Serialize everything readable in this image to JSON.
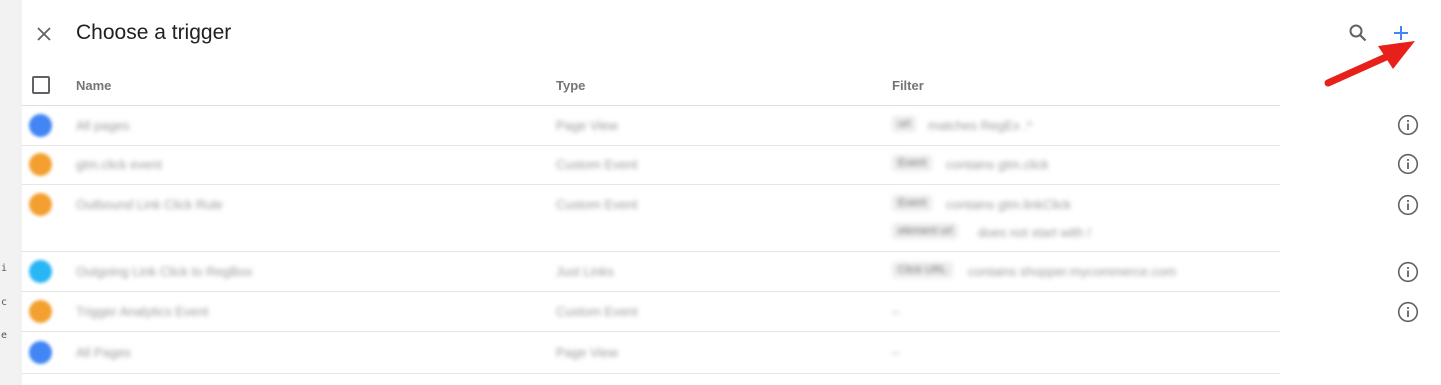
{
  "dialog": {
    "title": "Choose a trigger",
    "close_icon": "close-icon",
    "search_icon": "search-icon",
    "add_icon": "plus-icon",
    "accent_color": "#4285f4"
  },
  "table": {
    "columns": {
      "name": "Name",
      "type": "Type",
      "filter": "Filter"
    },
    "rows": [
      {
        "icon_color": "#4285f4",
        "name": "All pages",
        "type": "Page View",
        "filters": [
          {
            "chip": "url",
            "text": "matches RegEx .*"
          }
        ]
      },
      {
        "icon_color": "#f4a030",
        "name": "gtm.click event",
        "type": "Custom Event",
        "filters": [
          {
            "chip": "Event",
            "text": "contains gtm.click"
          }
        ]
      },
      {
        "icon_color": "#f4a030",
        "name": "Outbound Link Click Rule",
        "type": "Custom Event",
        "filters": [
          {
            "chip": "Event",
            "text": "contains gtm.linkClick"
          },
          {
            "chip": "element url",
            "text": "does not start with /"
          }
        ]
      },
      {
        "icon_color": "#29b6f6",
        "name": "Outgoing Link Click to RegBox",
        "type": "Just Links",
        "filters": [
          {
            "chip": "Click URL",
            "text": "contains shopper.mycommerce.com"
          }
        ]
      },
      {
        "icon_color": "#f4a030",
        "name": "Trigger Analytics Event",
        "type": "Custom Event",
        "filters": [
          {
            "chip": "",
            "text": "–"
          }
        ]
      },
      {
        "icon_color": "#4285f4",
        "name": "All Pages",
        "type": "Page View",
        "filters": [
          {
            "chip": "",
            "text": "–"
          }
        ]
      }
    ]
  },
  "annotation": {
    "arrow_color": "#e8201a"
  }
}
